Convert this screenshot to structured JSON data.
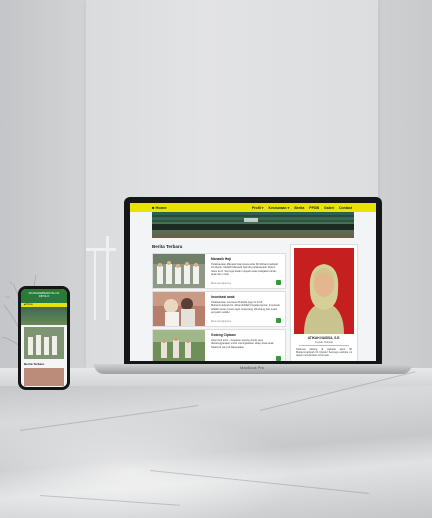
{
  "laptop": {
    "nav": {
      "home": "■ Home",
      "menu": [
        "Profil ▾",
        "Kesiswaan ▾",
        "Berita",
        "PPDB",
        "Galeri",
        "Contact"
      ]
    },
    "hero_logo": "",
    "section_title": "Berita Terbaru",
    "posts": [
      {
        "title": "Manasik Haji",
        "body": "Pelaksanaan Manasik Haji siswa-siswi MI Muhammadiyah 01 Dipolo. Melatih Manasik haji bila pelaksanaan Rukun Islam ke-5. Semoga kelak menjadi suatu kebijakan anak-anak dan untuk",
        "meta": "Baca selengkapnya"
      },
      {
        "title": "Imunisasi anak",
        "body": "Pelaksanaan imunisasi Rubella pagi ini di MI Muhammadiyah 01. Alhamdulillah berjalan lancar. Imunisasi adalah suatu proses agar seseorang ditimbang dari suatu penyakit melalui",
        "meta": "Baca selengkapnya"
      },
      {
        "title": "Gotong Ciptaan",
        "body": "Alqurrotul ainin - Kegiatan sosting dunia yang diselenggarakan untuk meningkatkan sikap anak-anak Nasional yang di laksanakan",
        "meta": ""
      }
    ],
    "sidebar": {
      "name": "ATIKAH NASISA, S.E.",
      "role": "Kepala Sekolah",
      "text": "Selamat datang di website kami MI Muhammadiyah 01 Dipolo! Semoga website ini dapat memberikan informasi..."
    },
    "base_label": "MacBook Pro"
  },
  "phone": {
    "header": "MI MUHAMMADIYAH 01 DIPOLO",
    "nav": "■ Home",
    "section_title": "Berita Terbaru"
  },
  "colors": {
    "nav_yellow": "#e8e400",
    "accent_green": "#2e9c3a",
    "photo_red": "#c5201f"
  }
}
